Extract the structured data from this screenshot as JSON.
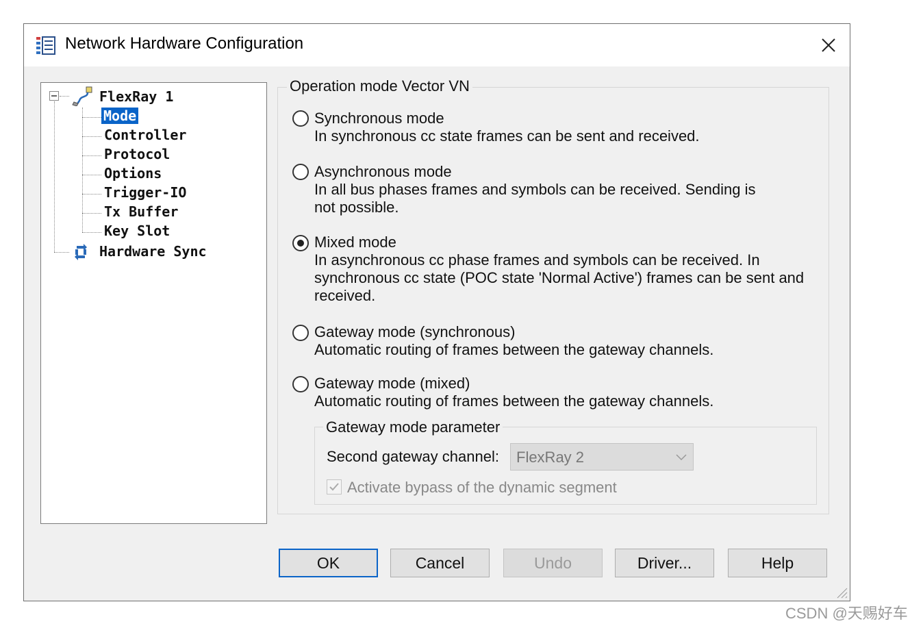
{
  "window": {
    "title": "Network Hardware Configuration",
    "app_icon": "network-config-icon",
    "close_icon": "close-icon"
  },
  "tree": {
    "root": {
      "label": "FlexRay 1",
      "icon": "flexray-cable-icon",
      "expanded": true
    },
    "children": [
      {
        "label": "Mode",
        "selected": true
      },
      {
        "label": "Controller"
      },
      {
        "label": "Protocol"
      },
      {
        "label": "Options"
      },
      {
        "label": "Trigger-IO"
      },
      {
        "label": "Tx Buffer"
      },
      {
        "label": "Key Slot"
      }
    ],
    "sibling": {
      "label": "Hardware Sync",
      "icon": "sync-arrows-icon"
    }
  },
  "operation_mode": {
    "group_title": "Operation mode Vector VN",
    "options": [
      {
        "label": "Synchronous mode",
        "description": "In synchronous cc state frames can be sent and received.",
        "checked": false
      },
      {
        "label": "Asynchronous mode",
        "description": "In all bus phases frames and symbols can be received. Sending is not possible.",
        "checked": false
      },
      {
        "label": "Mixed mode",
        "description": "In asynchronous cc phase frames and symbols can be received. In synchronous cc state (POC state 'Normal Active') frames can be sent and received.",
        "checked": true
      },
      {
        "label": "Gateway mode (synchronous)",
        "description": "Automatic routing of frames between the gateway channels.",
        "checked": false
      },
      {
        "label": "Gateway mode (mixed)",
        "description": "Automatic routing of frames between the gateway channels.",
        "checked": false
      }
    ]
  },
  "gateway_params": {
    "group_title": "Gateway mode parameter",
    "second_channel_label": "Second gateway channel:",
    "second_channel_value": "FlexRay 2",
    "bypass_label": "Activate bypass of the dynamic segment",
    "bypass_checked": true,
    "disabled": true
  },
  "buttons": {
    "ok": "OK",
    "cancel": "Cancel",
    "undo": "Undo",
    "driver": "Driver...",
    "help": "Help"
  },
  "watermark": "CSDN @天赐好车",
  "colors": {
    "selection": "#0a64c8",
    "dialog_bg": "#f0f0f0",
    "default_button_border": "#0a64c8"
  }
}
